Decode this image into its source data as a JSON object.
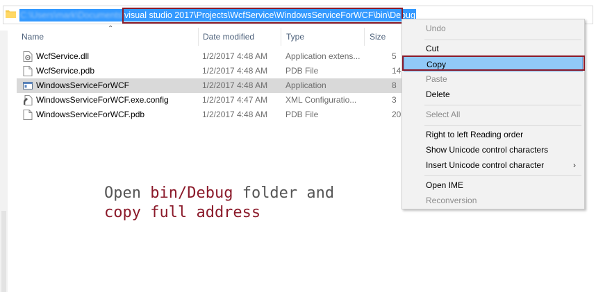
{
  "address": {
    "path_blurred": "C:\\Users\\mark\\Documents\\",
    "path_visible": "visual studio 2017\\Projects\\WcfService\\WindowsServiceForWCF\\bin\\Debug"
  },
  "columns": {
    "name": "Name",
    "date": "Date modified",
    "type": "Type",
    "size": "Size"
  },
  "files": [
    {
      "name": "WcfService.dll",
      "date": "1/2/2017 4:48 AM",
      "type": "Application extens...",
      "size": "5",
      "icon": "dll-file-icon"
    },
    {
      "name": "WcfService.pdb",
      "date": "1/2/2017 4:48 AM",
      "type": "PDB File",
      "size": "14",
      "icon": "file-icon"
    },
    {
      "name": "WindowsServiceForWCF",
      "date": "1/2/2017 4:48 AM",
      "type": "Application",
      "size": "8",
      "icon": "application-icon",
      "selected": true
    },
    {
      "name": "WindowsServiceForWCF.exe.config",
      "date": "1/2/2017 4:47 AM",
      "type": "XML Configuratio...",
      "size": "3",
      "icon": "config-file-icon"
    },
    {
      "name": "WindowsServiceForWCF.pdb",
      "date": "1/2/2017 4:48 AM",
      "type": "PDB File",
      "size": "20",
      "icon": "file-icon"
    }
  ],
  "annotation": {
    "line1_a": "Open ",
    "line1_b": "bin/Debug",
    "line1_c": " folder and",
    "line2": "copy full address"
  },
  "context_menu": {
    "undo": "Undo",
    "cut": "Cut",
    "copy": "Copy",
    "paste": "Paste",
    "delete": "Delete",
    "select_all": "Select All",
    "rtl": "Right to left Reading order",
    "show_unicode": "Show Unicode control characters",
    "insert_unicode": "Insert Unicode control character",
    "open_ime": "Open IME",
    "reconversion": "Reconversion"
  },
  "colors": {
    "highlight_border": "#8b1a2a",
    "selection": "#3399ff",
    "menu_hover": "#91c9f7"
  }
}
